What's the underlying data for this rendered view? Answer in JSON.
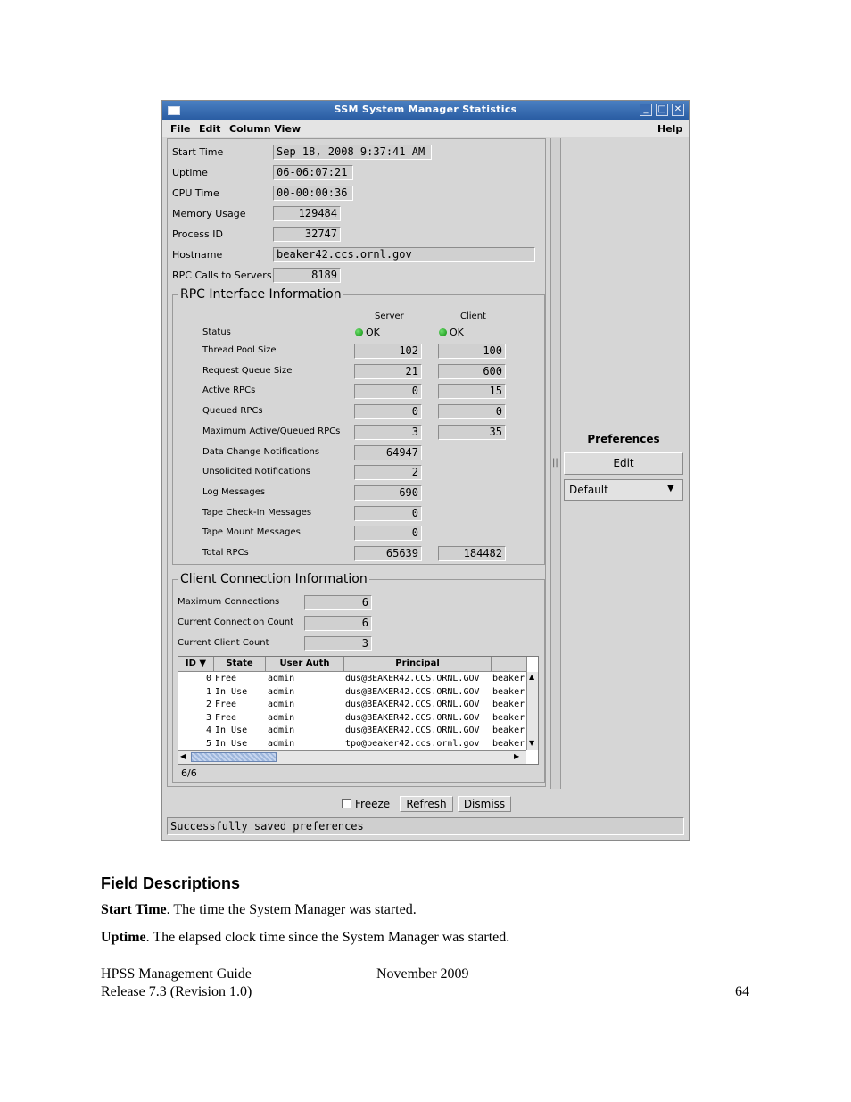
{
  "window": {
    "title": "SSM System Manager Statistics",
    "controls": {
      "minimize": "_",
      "maximize": "□",
      "close": "✕"
    },
    "menu": {
      "file": "File",
      "edit": "Edit",
      "column_view": "Column View",
      "help": "Help"
    },
    "stats": [
      {
        "label": "Start Time",
        "value": "Sep 18, 2008 9:37:41 AM"
      },
      {
        "label": "Uptime",
        "value": "06-06:07:21"
      },
      {
        "label": "CPU Time",
        "value": "00-00:00:36"
      },
      {
        "label": "Memory Usage",
        "value": "129484"
      },
      {
        "label": "Process ID",
        "value": "32747"
      },
      {
        "label": "Hostname",
        "value": "beaker42.ccs.ornl.gov"
      },
      {
        "label": "RPC Calls to Servers",
        "value": "8189"
      }
    ],
    "rpc": {
      "title": "RPC Interface Information",
      "server_header": "Server",
      "client_header": "Client",
      "status_label": "Status",
      "server_status": "OK",
      "client_status": "OK",
      "rows": [
        {
          "label": "Thread Pool Size",
          "server": "102",
          "client": "100"
        },
        {
          "label": "Request Queue Size",
          "server": "21",
          "client": "600"
        },
        {
          "label": "Active RPCs",
          "server": "0",
          "client": "15"
        },
        {
          "label": "Queued RPCs",
          "server": "0",
          "client": "0"
        },
        {
          "label": "Maximum Active/Queued RPCs",
          "server": "3",
          "client": "35"
        },
        {
          "label": "Data Change Notifications",
          "server": "64947",
          "client": ""
        },
        {
          "label": "Unsolicited Notifications",
          "server": "2",
          "client": ""
        },
        {
          "label": "Log Messages",
          "server": "690",
          "client": ""
        },
        {
          "label": "Tape Check-In Messages",
          "server": "0",
          "client": ""
        },
        {
          "label": "Tape Mount Messages",
          "server": "0",
          "client": ""
        },
        {
          "label": "Total RPCs",
          "server": "65639",
          "client": "184482"
        }
      ]
    },
    "client_conn": {
      "title": "Client Connection Information",
      "rows": [
        {
          "label": "Maximum Connections",
          "value": "6"
        },
        {
          "label": "Current Connection Count",
          "value": "6"
        },
        {
          "label": "Current Client Count",
          "value": "3"
        }
      ],
      "table": {
        "headers": [
          "ID ▼",
          "State",
          "User Auth",
          "Principal"
        ],
        "rows": [
          {
            "id": "0",
            "state": "Free",
            "auth": "admin",
            "principal": "dus@BEAKER42.CCS.ORNL.GOV",
            "extra": "beaker"
          },
          {
            "id": "1",
            "state": "In Use",
            "auth": "admin",
            "principal": "dus@BEAKER42.CCS.ORNL.GOV",
            "extra": "beaker"
          },
          {
            "id": "2",
            "state": "Free",
            "auth": "admin",
            "principal": "dus@BEAKER42.CCS.ORNL.GOV",
            "extra": "beaker"
          },
          {
            "id": "3",
            "state": "Free",
            "auth": "admin",
            "principal": "dus@BEAKER42.CCS.ORNL.GOV",
            "extra": "beaker"
          },
          {
            "id": "4",
            "state": "In Use",
            "auth": "admin",
            "principal": "dus@BEAKER42.CCS.ORNL.GOV",
            "extra": "beaker"
          },
          {
            "id": "5",
            "state": "In Use",
            "auth": "admin",
            "principal": "tpo@beaker42.ccs.ornl.gov",
            "extra": "beaker"
          }
        ]
      },
      "row_count": "6/6"
    },
    "preferences": {
      "title": "Preferences",
      "edit": "Edit",
      "selected": "Default"
    },
    "splitter": "||",
    "buttons": {
      "freeze": "Freeze",
      "refresh": "Refresh",
      "dismiss": "Dismiss"
    },
    "status": "Successfully saved preferences"
  },
  "document": {
    "heading": "Field Descriptions",
    "para1_term": "Start Time",
    "para1_text": ". The time the System Manager was started.",
    "para2_term": "Uptime",
    "para2_text": ". The elapsed clock time since the System Manager was started.",
    "footer_left1": "HPSS Management Guide",
    "footer_left2": "Release 7.3 (Revision 1.0)",
    "footer_center": "November 2009",
    "footer_page": "64"
  }
}
